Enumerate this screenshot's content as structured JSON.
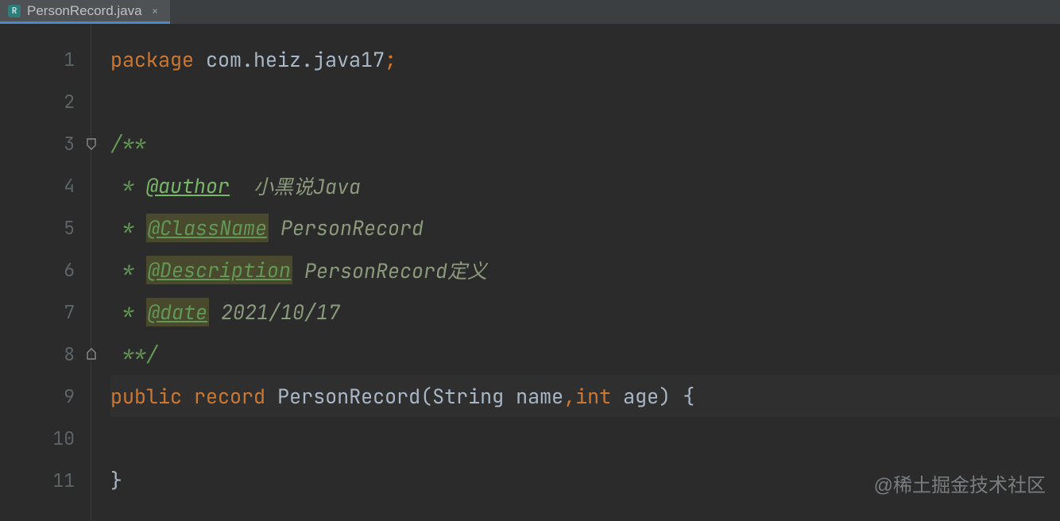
{
  "tab": {
    "icon_letter": "R",
    "filename": "PersonRecord.java",
    "close_glyph": "×"
  },
  "gutter": {
    "lines": [
      "1",
      "2",
      "3",
      "4",
      "5",
      "6",
      "7",
      "8",
      "9",
      "10",
      "11"
    ]
  },
  "code": {
    "l1": {
      "kw": "package",
      "pkg": " com.heiz.java17",
      "semi": ";"
    },
    "l3": {
      "open": "/**"
    },
    "l4": {
      "prefix": " * ",
      "tag": "@author",
      "desc": "  小黑说Java"
    },
    "l5": {
      "prefix": " * ",
      "tag": "@ClassName",
      "desc": " PersonRecord"
    },
    "l6": {
      "prefix": " * ",
      "tag": "@Description",
      "desc": " PersonRecord定义"
    },
    "l7": {
      "prefix": " * ",
      "tag": "@date",
      "desc": " 2021/10/17"
    },
    "l8": {
      "close": " **/"
    },
    "l9": {
      "kw1": "public",
      "kw2": "record",
      "name": "PersonRecord",
      "p_open": "(",
      "t1": "String",
      "n1": " name",
      "comma": ",",
      "t2": "int",
      "n2": " age",
      "p_close": ")",
      "brace": " {"
    },
    "l11": {
      "brace": "}"
    }
  },
  "watermark": "@稀土掘金技术社区"
}
